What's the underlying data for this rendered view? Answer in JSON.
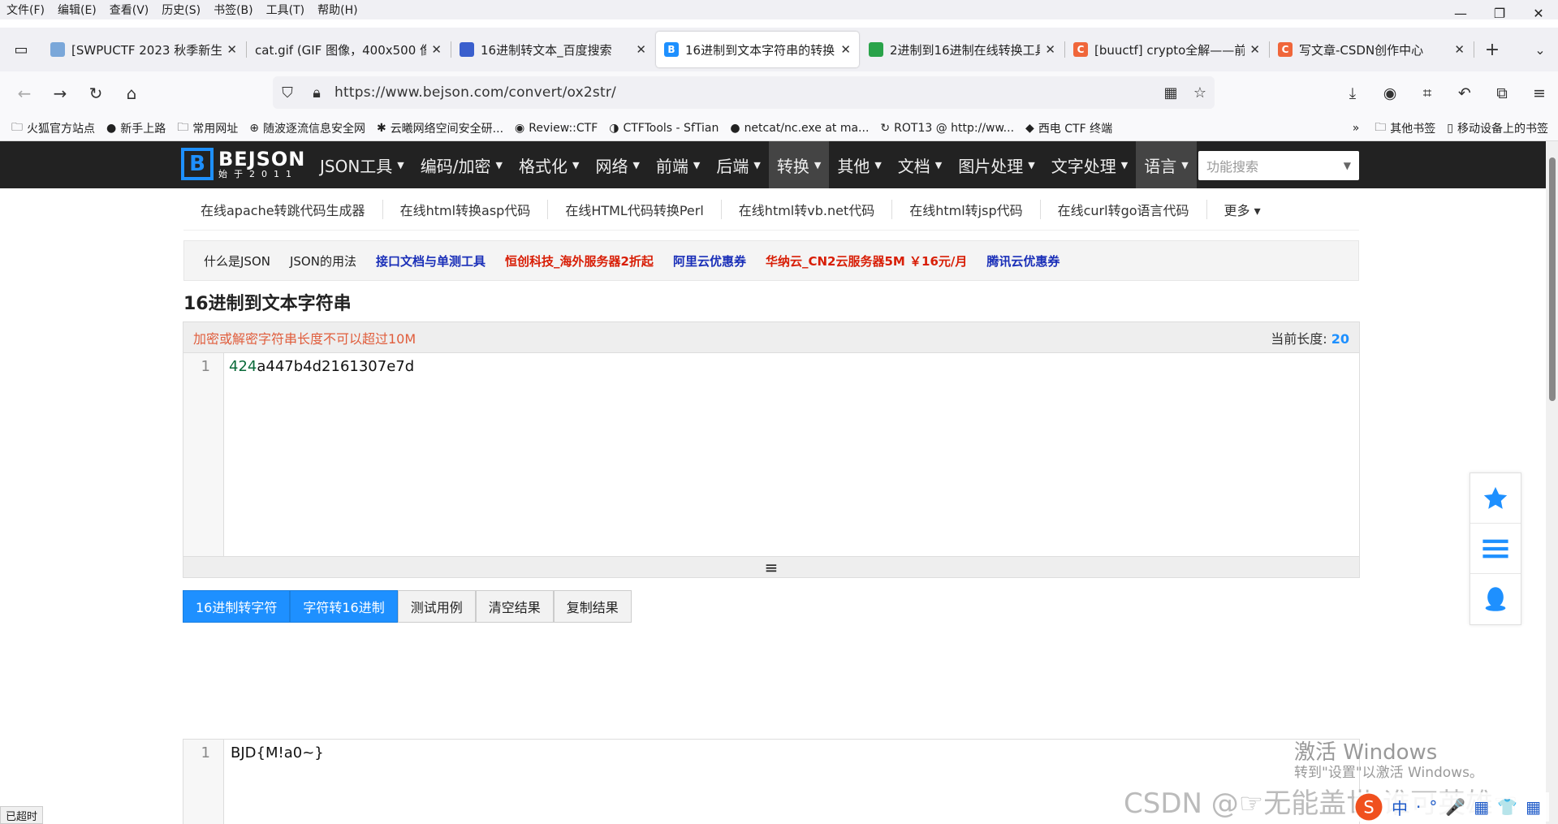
{
  "menu": [
    "文件(F)",
    "编辑(E)",
    "查看(V)",
    "历史(S)",
    "书签(B)",
    "工具(T)",
    "帮助(H)"
  ],
  "window_controls": {
    "minimize": "—",
    "restore": "❐",
    "close": "✕"
  },
  "tabs": [
    {
      "title": "[SWPUCTF 2023 秋季新生",
      "fav_color": "#7aa7d9",
      "fav": "",
      "active": false
    },
    {
      "title": "cat.gif (GIF 图像，400x500 像",
      "fav_color": "",
      "fav": "",
      "active": false
    },
    {
      "title": "16进制转文本_百度搜索",
      "fav_color": "#3a5fcd",
      "fav": "",
      "active": false
    },
    {
      "title": "16进制到文本字符串的转换",
      "fav_color": "#1e90ff",
      "fav": "B",
      "active": true
    },
    {
      "title": "2进制到16进制在线转换工具",
      "fav_color": "#2aa34a",
      "fav": "",
      "active": false
    },
    {
      "title": "[buuctf] crypto全解——前",
      "fav_color": "#f0663a",
      "fav": "C",
      "active": false
    },
    {
      "title": "写文章-CSDN创作中心",
      "fav_color": "#f0663a",
      "fav": "C",
      "active": false
    }
  ],
  "address": {
    "url": "https://www.bejson.com/convert/ox2str/"
  },
  "bookmarks": [
    {
      "icon": "folder-icon",
      "glyph": "🗀",
      "label": "火狐官方站点"
    },
    {
      "icon": "firefox-icon",
      "glyph": "●",
      "label": "新手上路"
    },
    {
      "icon": "folder-icon",
      "glyph": "🗀",
      "label": "常用网址"
    },
    {
      "icon": "globe-icon",
      "glyph": "⊕",
      "label": "随波逐流信息安全网"
    },
    {
      "icon": "paw-icon",
      "glyph": "✱",
      "label": "云曦网络空间安全研..."
    },
    {
      "icon": "circle-icon",
      "glyph": "◉",
      "label": "Review::CTF"
    },
    {
      "icon": "wave-icon",
      "glyph": "◑",
      "label": "CTFTools - SfTian"
    },
    {
      "icon": "github-icon",
      "glyph": "●",
      "label": "netcat/nc.exe at ma..."
    },
    {
      "icon": "rot13-icon",
      "glyph": "↻",
      "label": "ROT13 @ http://ww..."
    },
    {
      "icon": "fish-icon",
      "glyph": "◆",
      "label": "西电 CTF 终端"
    }
  ],
  "bookmarks_right": [
    {
      "icon": "chevrons-icon",
      "glyph": "»",
      "label": ""
    },
    {
      "icon": "folder-icon",
      "glyph": "🗀",
      "label": "其他书签"
    },
    {
      "icon": "mobile-icon",
      "glyph": "▯",
      "label": "移动设备上的书签"
    }
  ],
  "site": {
    "logo_letter": "B",
    "logo_name": "BEJSON",
    "logo_sub": "始于2011",
    "menus": [
      {
        "label": "JSON工具",
        "hl": false
      },
      {
        "label": "编码/加密",
        "hl": false
      },
      {
        "label": "格式化",
        "hl": false
      },
      {
        "label": "网络",
        "hl": false
      },
      {
        "label": "前端",
        "hl": false
      },
      {
        "label": "后端",
        "hl": false
      },
      {
        "label": "转换",
        "hl": true
      },
      {
        "label": "其他",
        "hl": false
      },
      {
        "label": "文档",
        "hl": false
      },
      {
        "label": "图片处理",
        "hl": false
      },
      {
        "label": "文字处理",
        "hl": false
      },
      {
        "label": "语言",
        "hl": true
      }
    ],
    "search_placeholder": "功能搜索"
  },
  "sublinks": [
    "在线apache转跳代码生成器",
    "在线html转换asp代码",
    "在线HTML代码转换Perl",
    "在线html转vb.net代码",
    "在线html转jsp代码",
    "在线curl转go语言代码",
    "更多"
  ],
  "ads": [
    {
      "label": "什么是JSON",
      "color": "#222"
    },
    {
      "label": "JSON的用法",
      "color": "#222"
    },
    {
      "label": "接口文档与单测工具",
      "color": "#1a2fb8"
    },
    {
      "label": "恒创科技_海外服务器2折起",
      "color": "#d81e06"
    },
    {
      "label": "阿里云优惠券",
      "color": "#1a2fb8"
    },
    {
      "label": "华纳云_CN2云服务器5M ￥16元/月",
      "color": "#d81e06"
    },
    {
      "label": "腾讯云优惠券",
      "color": "#1a2fb8"
    }
  ],
  "page_title": "16进制到文本字符串",
  "editor": {
    "warning": "加密或解密字符串长度不可以超过10M",
    "length_label": "当前长度:",
    "length_value": "20",
    "line_no": "1",
    "input_prefix": "424",
    "input_rest": "a447b4d2161307e7d",
    "resize_glyph": "≡"
  },
  "buttons": [
    {
      "label": "16进制转字符",
      "primary": true
    },
    {
      "label": "字符转16进制",
      "primary": true
    },
    {
      "label": "测试用例",
      "primary": false
    },
    {
      "label": "清空结果",
      "primary": false
    },
    {
      "label": "复制结果",
      "primary": false
    }
  ],
  "result": {
    "line_no": "1",
    "text": "BJD{M!a0~}"
  },
  "status_text": "已超时",
  "watermark": {
    "line1": "激活 Windows",
    "line2": "转到\"设置\"以激活 Windows。"
  },
  "csdn_watermark": "CSDN @☞无能盖世·谁可英雄☜",
  "ime": [
    "中",
    "·",
    "°",
    "🎤",
    "▦",
    "👕",
    "▦"
  ],
  "colors": {
    "accent": "#1e90ff",
    "nav_bg": "#222222",
    "warning": "#e05d3c"
  }
}
